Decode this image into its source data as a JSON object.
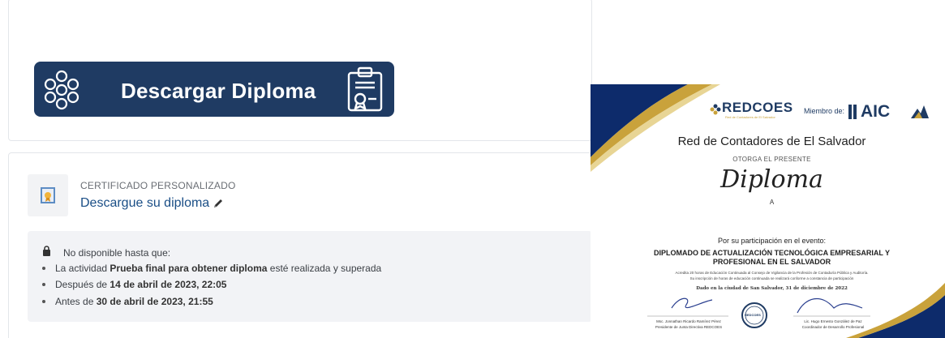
{
  "download_button": {
    "label": "Descargar Diploma"
  },
  "module": {
    "type_label": "CERTIFICADO PERSONALIZADO",
    "name": "Descargue su diploma"
  },
  "restrictions": {
    "header": "No disponible hasta que:",
    "items": [
      {
        "prefix": "La actividad ",
        "bold": "Prueba final para obtener diploma",
        "suffix": " esté realizada y superada"
      },
      {
        "prefix": "Después de ",
        "bold": "14 de abril de 2023, 22:05",
        "suffix": ""
      },
      {
        "prefix": "Antes de ",
        "bold": "30 de abril de 2023, 21:55",
        "suffix": ""
      }
    ]
  },
  "certificate": {
    "logo_text": "REDCOES",
    "logo_sub": "Red de Contadores de El Salvador",
    "member_label": "Miembro de:",
    "aic_label": "AIC",
    "org_name": "Red de Contadores de El Salvador",
    "grants": "OTORGA EL PRESENTE",
    "title": "Diploma",
    "to": "A",
    "participation": "Por su participación en el evento:",
    "event_line1": "DIPLOMADO DE ACTUALIZACIÓN TECNOLÓGICA EMPRESARIAL Y",
    "event_line2": "PROFESIONAL EN EL SALVADOR",
    "desc_line1": "Acredita 20 horas de Educación Continuada al Consejo de Vigilancia de la Profesión de Contaduría Pública y Auditoría.",
    "desc_line2": "Su inscripción de horas de educación continuada se realizará conforme a constancia de participación",
    "dated": "Dado en la ciudad de San Salvador, 31 de diciembre de 2022",
    "seal_text": "REDCOES",
    "sig1_name": "Msc. Jonnathan Ricardo Ramírez Pérez",
    "sig1_role": "Presidente de Junta Directiva REDCOES",
    "sig2_name": "Lic. Hugo Ernesto González de Paz",
    "sig2_role": "Coordinador de Desarrollo Profesional"
  },
  "colors": {
    "button_bg": "#1f3b63",
    "link_blue": "#1a4e86",
    "cert_navy": "#0d2b6b",
    "cert_gold": "#c9a23b"
  }
}
